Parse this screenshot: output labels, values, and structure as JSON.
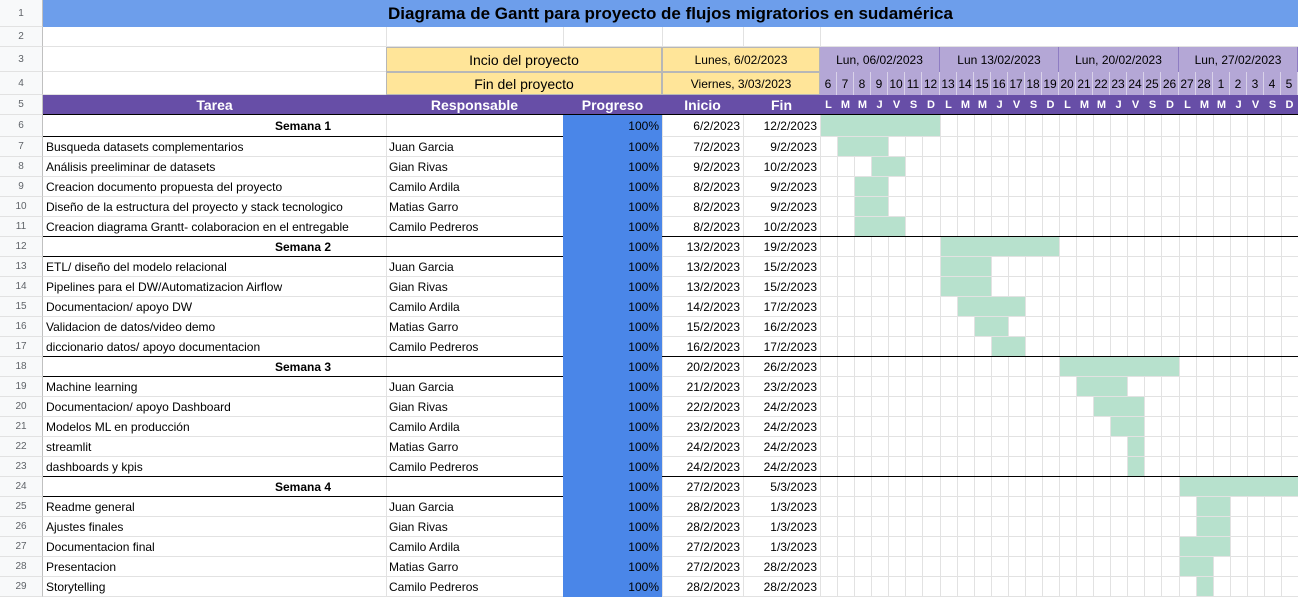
{
  "title": "Diagrama de Gantt para proyecto de flujos migratorios en sudamérica",
  "project": {
    "start_label": "Incio del proyecto",
    "start_value": "Lunes, 6/02/2023",
    "end_label": "Fin del proyecto",
    "end_value": "Viernes, 3/03/2023"
  },
  "weeks": [
    "Lun, 06/02/2023",
    "Lun 13/02/2023",
    "Lun, 20/02/2023",
    "Lun, 27/02/2023"
  ],
  "day_numbers": [
    "6",
    "7",
    "8",
    "9",
    "10",
    "11",
    "12",
    "13",
    "14",
    "15",
    "16",
    "17",
    "18",
    "19",
    "20",
    "21",
    "22",
    "23",
    "24",
    "25",
    "26",
    "27",
    "28",
    "1",
    "2",
    "3",
    "4",
    "5"
  ],
  "day_letters": [
    "L",
    "M",
    "M",
    "J",
    "V",
    "S",
    "D",
    "L",
    "M",
    "M",
    "J",
    "V",
    "S",
    "D",
    "L",
    "M",
    "M",
    "J",
    "V",
    "S",
    "D",
    "L",
    "M",
    "M",
    "J",
    "V",
    "S",
    "D"
  ],
  "columns": {
    "task": "Tarea",
    "owner": "Responsable",
    "progress": "Progreso",
    "start": "Inicio",
    "end": "Fin"
  },
  "rows": [
    {
      "type": "week",
      "task": "Semana 1",
      "progress": "100%",
      "start": "6/2/2023",
      "end": "12/2/2023",
      "bar": [
        0,
        6
      ]
    },
    {
      "type": "task",
      "task": "Busqueda datasets complementarios",
      "owner": "Juan Garcia",
      "progress": "100%",
      "start": "7/2/2023",
      "end": "9/2/2023",
      "bar": [
        1,
        3
      ]
    },
    {
      "type": "task",
      "task": "Análisis preeliminar de datasets",
      "owner": "Gian Rivas",
      "progress": "100%",
      "start": "9/2/2023",
      "end": "10/2/2023",
      "bar": [
        3,
        4
      ]
    },
    {
      "type": "task",
      "task": "Creacion documento propuesta del proyecto",
      "owner": "Camilo Ardila",
      "progress": "100%",
      "start": "8/2/2023",
      "end": "9/2/2023",
      "bar": [
        2,
        3
      ]
    },
    {
      "type": "task",
      "task": "Diseño de la estructura del proyecto y stack tecnologico",
      "owner": "Matias Garro",
      "progress": "100%",
      "start": "8/2/2023",
      "end": "9/2/2023",
      "bar": [
        2,
        3
      ]
    },
    {
      "type": "task",
      "task": "Creacion diagrama Grantt- colaboracion en el entregable",
      "owner": "Camilo Pedreros",
      "progress": "100%",
      "start": "8/2/2023",
      "end": "10/2/2023",
      "bar": [
        2,
        4
      ]
    },
    {
      "type": "week",
      "task": "Semana 2",
      "progress": "100%",
      "start": "13/2/2023",
      "end": "19/2/2023",
      "bar": [
        7,
        13
      ]
    },
    {
      "type": "task",
      "task": "ETL/ diseño del modelo relacional",
      "owner": " Juan Garcia",
      "progress": "100%",
      "start": "13/2/2023",
      "end": "15/2/2023",
      "bar": [
        7,
        9
      ]
    },
    {
      "type": "task",
      "task": "Pipelines para el DW/Automatizacion Airflow",
      "owner": "Gian Rivas",
      "progress": "100%",
      "start": "13/2/2023",
      "end": "15/2/2023",
      "bar": [
        7,
        9
      ]
    },
    {
      "type": "task",
      "task": "Documentacion/ apoyo DW",
      "owner": "Camilo Ardila",
      "progress": "100%",
      "start": "14/2/2023",
      "end": "17/2/2023",
      "bar": [
        8,
        11
      ]
    },
    {
      "type": "task",
      "task": "Validacion de datos/video demo",
      "owner": "Matias Garro",
      "progress": "100%",
      "start": "15/2/2023",
      "end": "16/2/2023",
      "bar": [
        9,
        10
      ]
    },
    {
      "type": "task",
      "task": "diccionario datos/ apoyo documentacion",
      "owner": "Camilo Pedreros",
      "progress": "100%",
      "start": "16/2/2023",
      "end": "17/2/2023",
      "bar": [
        10,
        11
      ]
    },
    {
      "type": "week",
      "task": "Semana 3",
      "progress": "100%",
      "start": "20/2/2023",
      "end": "26/2/2023",
      "bar": [
        14,
        20
      ]
    },
    {
      "type": "task",
      "task": "Machine learning",
      "owner": "Juan Garcia",
      "progress": "100%",
      "start": "21/2/2023",
      "end": "23/2/2023",
      "bar": [
        15,
        17
      ]
    },
    {
      "type": "task",
      "task": "Documentacion/ apoyo Dashboard",
      "owner": "Gian Rivas",
      "progress": "100%",
      "start": "22/2/2023",
      "end": "24/2/2023",
      "bar": [
        16,
        18
      ]
    },
    {
      "type": "task",
      "task": "Modelos ML en producción",
      "owner": "Camilo Ardila",
      "progress": "100%",
      "start": "23/2/2023",
      "end": "24/2/2023",
      "bar": [
        17,
        18
      ]
    },
    {
      "type": "task",
      "task": "streamlit",
      "owner": "Matias Garro",
      "progress": "100%",
      "start": "24/2/2023",
      "end": "24/2/2023",
      "bar": [
        18,
        18
      ]
    },
    {
      "type": "task",
      "task": "dashboards y kpis",
      "owner": "Camilo Pedreros",
      "progress": "100%",
      "start": "24/2/2023",
      "end": "24/2/2023",
      "bar": [
        18,
        18
      ]
    },
    {
      "type": "week",
      "task": "Semana 4",
      "progress": "100%",
      "start": "27/2/2023",
      "end": "5/3/2023",
      "bar": [
        21,
        27
      ]
    },
    {
      "type": "task",
      "task": "Readme general",
      "owner": "Juan Garcia",
      "progress": "100%",
      "start": "28/2/2023",
      "end": "1/3/2023",
      "bar": [
        22,
        23
      ]
    },
    {
      "type": "task",
      "task": "Ajustes finales",
      "owner": "Gian Rivas",
      "progress": "100%",
      "start": "28/2/2023",
      "end": "1/3/2023",
      "bar": [
        22,
        23
      ]
    },
    {
      "type": "task",
      "task": "Documentacion final",
      "owner": "Camilo Ardila",
      "progress": "100%",
      "start": "27/2/2023",
      "end": "1/3/2023",
      "bar": [
        21,
        23
      ]
    },
    {
      "type": "task",
      "task": "Presentacion",
      "owner": "Matias Garro",
      "progress": "100%",
      "start": "27/2/2023",
      "end": "28/2/2023",
      "bar": [
        21,
        22
      ]
    },
    {
      "type": "task",
      "task": "Storytelling",
      "owner": "Camilo Pedreros",
      "progress": "100%",
      "start": "28/2/2023",
      "end": "28/2/2023",
      "bar": [
        22,
        22
      ]
    }
  ],
  "colors": {
    "title_bg": "#6d9eeb",
    "header_bg": "#674ea7",
    "week_header_bg": "#b4a7d6",
    "project_info_bg": "#ffe599",
    "progress_fill": "#4a86e8",
    "gantt_bar": "#b7e1cd"
  }
}
